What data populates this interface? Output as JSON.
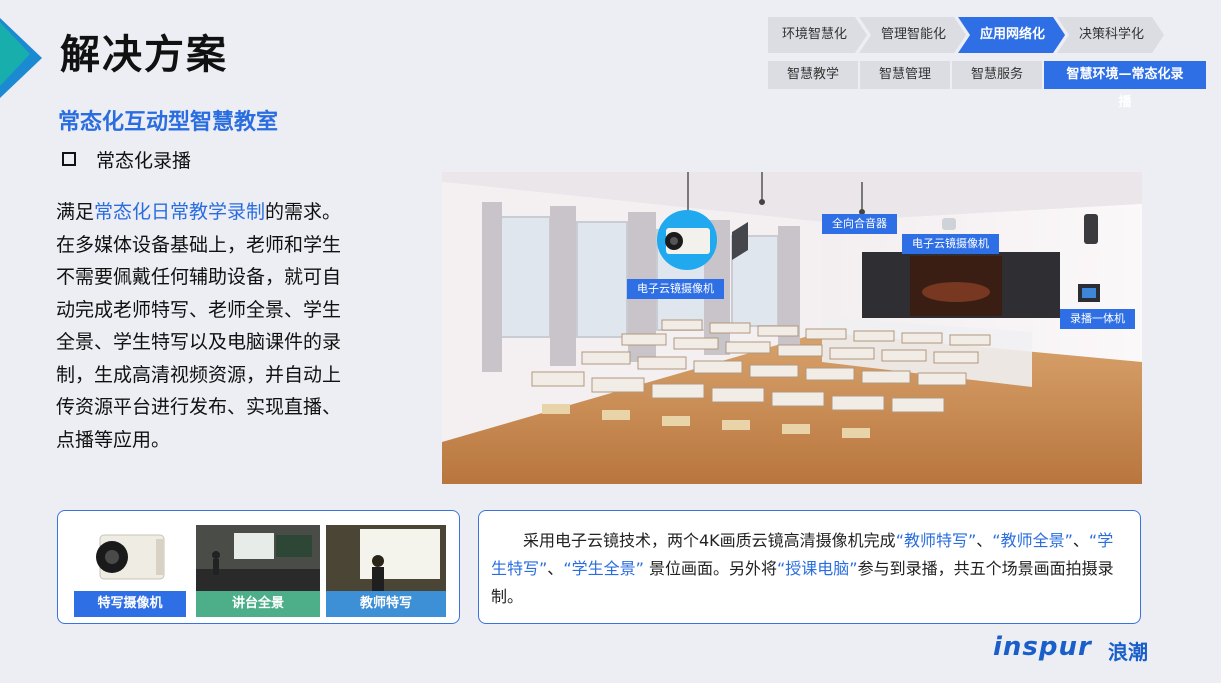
{
  "header": {
    "title": "解决方案"
  },
  "nav": {
    "steps": [
      "环境智慧化",
      "管理智能化",
      "应用网络化",
      "决策科学化"
    ],
    "active_step": 2,
    "subtabs": [
      "智慧教学",
      "智慧管理",
      "智慧服务",
      "智慧环境—常态化录播"
    ],
    "active_subtab": 3
  },
  "content": {
    "subtitle": "常态化互动型智慧教室",
    "bullet": "常态化录播",
    "desc_prefix": "满足",
    "desc_highlight": "常态化日常教学录制",
    "desc_rest": "的需求。在多媒体设备基础上，老师和学生不需要佩戴任何辅助设备，就可自动完成老师特写、老师全景、学生全景、学生特写以及电脑课件的录制，生成高清视频资源，并自动上传资源平台进行发布、实现直播、点播等应用。"
  },
  "classroom": {
    "tag_camera_left": "电子云镜摄像机",
    "tag_speaker": "全向合音器",
    "tag_camera_right": "电子云镜摄像机",
    "tag_recorder": "录播一体机"
  },
  "thumbnails": [
    {
      "label": "特写摄像机",
      "color": "#2f6fe6"
    },
    {
      "label": "讲台全景",
      "color": "#4caf8a"
    },
    {
      "label": "教师特写",
      "color": "#3d8fd6"
    }
  ],
  "info": {
    "p1": "采用电子云镜技术，两个4K画质云镜高清摄像机完成",
    "h1": "“教师特写”",
    "s1": "、",
    "h2": "“教师全景”",
    "s2": "、",
    "h3": "“学生特写”",
    "s3": "、",
    "h4": "“学生全景”",
    "p2": " 景位画面。另外将",
    "h5": "“授课电脑”",
    "p3": "参与到录播，共五个场景画面拍摄录制。"
  },
  "brand": {
    "logo": "inspur",
    "logo_cn": "浪潮"
  }
}
